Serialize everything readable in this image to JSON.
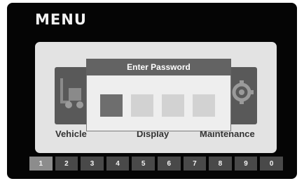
{
  "title": "MENU",
  "menu_items": [
    {
      "label": "Vehicle",
      "icon": "forklift-icon"
    },
    {
      "label": "Display",
      "icon": "display-icon"
    },
    {
      "label": "Maintenance",
      "icon": "gear-icon"
    }
  ],
  "visible_labels": {
    "vehicle": "Vehicle",
    "display": "Display",
    "maintenance": "Maintenance"
  },
  "dialog": {
    "title": "Enter Password",
    "digits_entered": 1,
    "digits_total": 4
  },
  "keypad": {
    "keys": [
      "1",
      "2",
      "3",
      "4",
      "5",
      "6",
      "7",
      "8",
      "9",
      "0"
    ],
    "highlighted_key": "1"
  },
  "colors": {
    "screen_bg": "#050505",
    "panel_bg": "#e3e3e3",
    "header_bg": "#636363",
    "key_bg": "#494949",
    "key_active_bg": "#8c8c8c"
  }
}
